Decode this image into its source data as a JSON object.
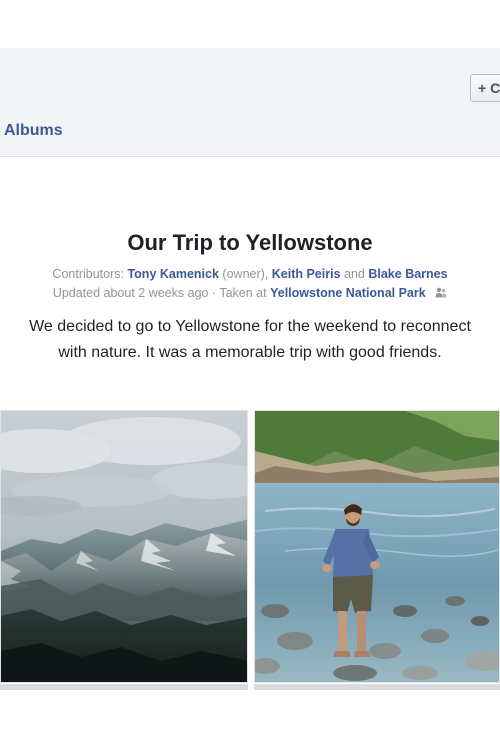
{
  "header": {
    "create_button_label": "+ C",
    "albums_link": "Albums"
  },
  "album": {
    "title": "Our Trip to Yellowstone",
    "contributors_label": "Contributors:",
    "contributors": [
      {
        "name": "Tony Kamenick",
        "role": "(owner)"
      },
      {
        "name": "Keith Peiris"
      },
      {
        "name": "Blake Barnes"
      }
    ],
    "and_word": "and",
    "updated_text": "Updated about 2 weeks ago · Taken at",
    "location": "Yellowstone National Park",
    "description_line1": "We decided to go to Yellowstone for the weekend to reconnect",
    "description_line2": "with nature. It was a memorable trip with good friends."
  },
  "photos": [
    {
      "subject": "mountain-landscape"
    },
    {
      "subject": "man-wading-river"
    }
  ],
  "icons": {
    "create": "plus-icon",
    "tag": "people-tag-icon"
  },
  "colors": {
    "link": "#3b5998",
    "muted": "#90949c",
    "text": "#1d2129",
    "header_bg": "#f3f4f7"
  }
}
